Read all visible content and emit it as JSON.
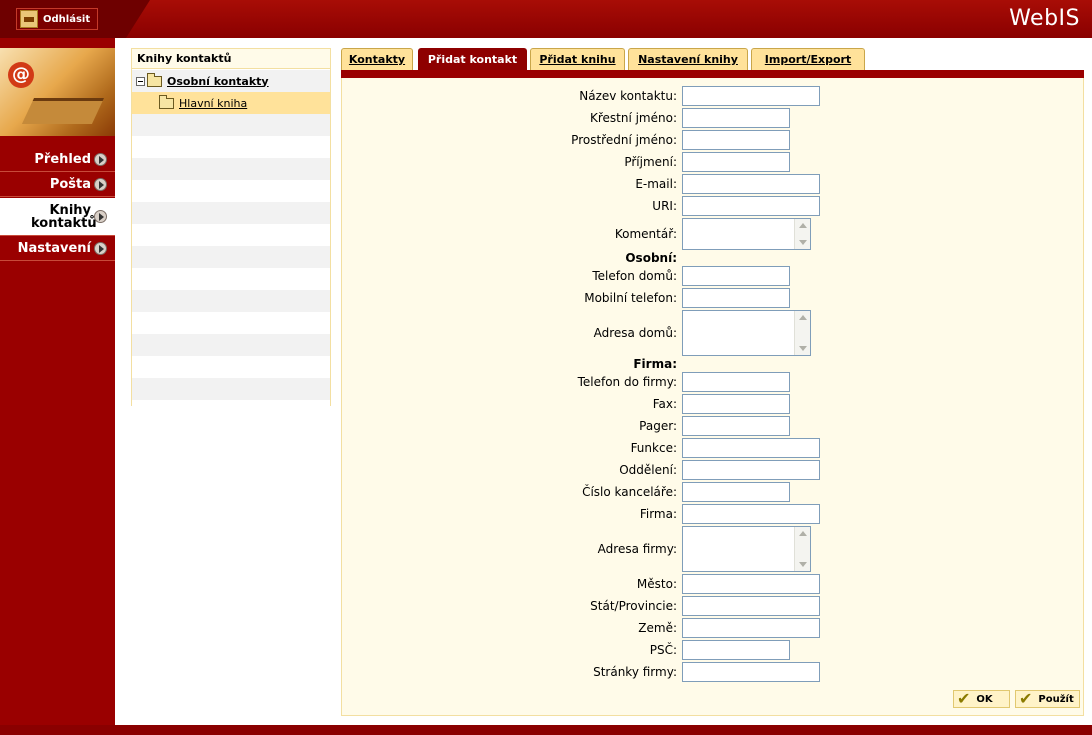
{
  "header": {
    "logout_label": "Odhlásit",
    "brand": "WebIS"
  },
  "nav": [
    {
      "label": "Přehled"
    },
    {
      "label": "Pošta"
    },
    {
      "label": "Knihy kontaktů"
    },
    {
      "label": "Nastavení"
    }
  ],
  "books": {
    "title": "Knihy kontaktů",
    "root": "Osobní kontakty",
    "child": "Hlavní kniha"
  },
  "tabs": [
    {
      "label": "Kontakty"
    },
    {
      "label": "Přidat kontakt"
    },
    {
      "label": "Přidat knihu"
    },
    {
      "label": "Nastavení knihy"
    },
    {
      "label": "Import/Export"
    }
  ],
  "form": {
    "name": "Název kontaktu:",
    "first": "Křestní jméno:",
    "middle": "Prostřední jméno:",
    "last": "Příjmení:",
    "email": "E-mail:",
    "uri": "URI:",
    "comment": "Komentář:",
    "personal": "Osobní:",
    "home_phone": "Telefon domů:",
    "mobile": "Mobilní telefon:",
    "home_address": "Adresa domů:",
    "company_section": "Firma:",
    "work_phone": "Telefon do firmy:",
    "fax": "Fax:",
    "pager": "Pager:",
    "position": "Funkce:",
    "department": "Oddělení:",
    "office": "Číslo kanceláře:",
    "company": "Firma:",
    "company_address": "Adresa firmy:",
    "city": "Město:",
    "state": "Stát/Provincie:",
    "country": "Země:",
    "zip": "PSČ:",
    "website": "Stránky firmy:"
  },
  "buttons": {
    "ok": "OK",
    "apply": "Použít"
  }
}
